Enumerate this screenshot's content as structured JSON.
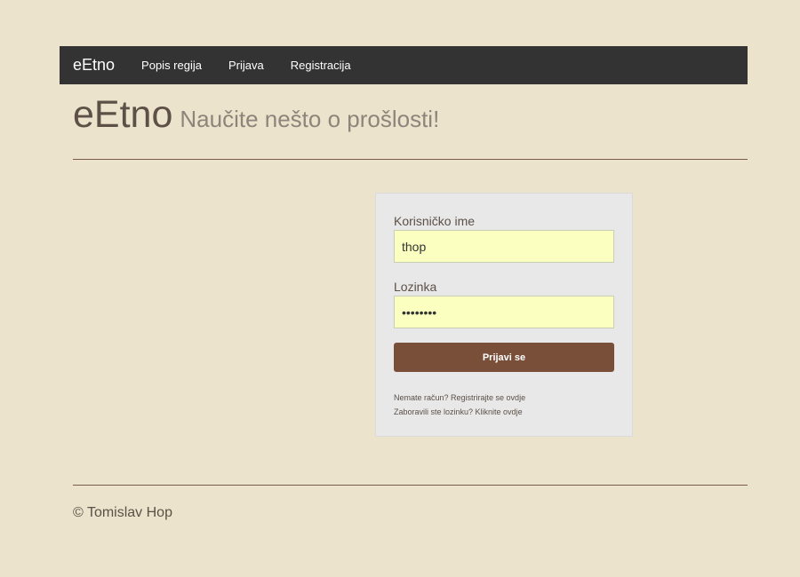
{
  "navbar": {
    "brand": "eEtno",
    "items": [
      {
        "label": "Popis regija"
      },
      {
        "label": "Prijava"
      },
      {
        "label": "Registracija"
      }
    ]
  },
  "header": {
    "title": "eEtno",
    "subtitle": "Naučite nešto o prošlosti!"
  },
  "login": {
    "username_label": "Korisničko ime",
    "username_value": "thop",
    "password_label": "Lozinka",
    "password_value": "xxxxxxxx",
    "submit_label": "Prijavi se",
    "register_link": "Nemate račun? Registrirajte se ovdje",
    "forgot_link": "Zaboravili ste lozinku? Kliknite ovdje"
  },
  "footer": {
    "copyright": "© Tomislav Hop"
  },
  "colors": {
    "background": "#ebe3cb",
    "navbar": "#333333",
    "button": "#7a4f39",
    "input_autofill": "#fbffc0"
  }
}
